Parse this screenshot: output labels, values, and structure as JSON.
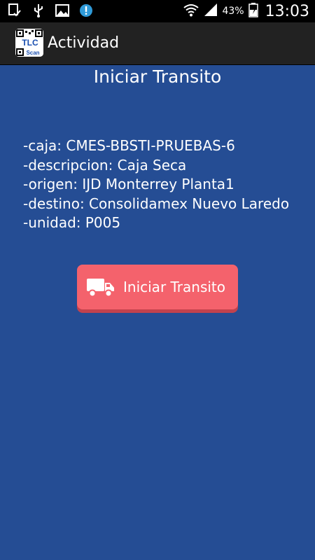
{
  "status_bar": {
    "battery_percent": "43%",
    "time": "13:03",
    "icons": [
      "download-check-icon",
      "usb-icon",
      "image-icon",
      "alert-icon",
      "wifi-icon",
      "signal-icon",
      "battery-icon"
    ]
  },
  "action_bar": {
    "app_icon_text_top": "TLC",
    "app_icon_text_bottom": "Scan",
    "title": "Actividad"
  },
  "screen": {
    "heading": "Iniciar Transito",
    "details": {
      "caja": "-caja: CMES-BBSTI-PRUEBAS-6",
      "descripcion": "-descripcion: Caja Seca",
      "origen": "-origen: IJD Monterrey Planta1",
      "destino": "-destino: Consolidamex Nuevo Laredo",
      "unidad": "-unidad: P005"
    },
    "button": {
      "label": "Iniciar Transito",
      "icon": "truck-icon",
      "color": "#f4626c"
    }
  },
  "colors": {
    "background": "#254d94",
    "action_bar": "#222222",
    "status_bar": "#000000"
  }
}
